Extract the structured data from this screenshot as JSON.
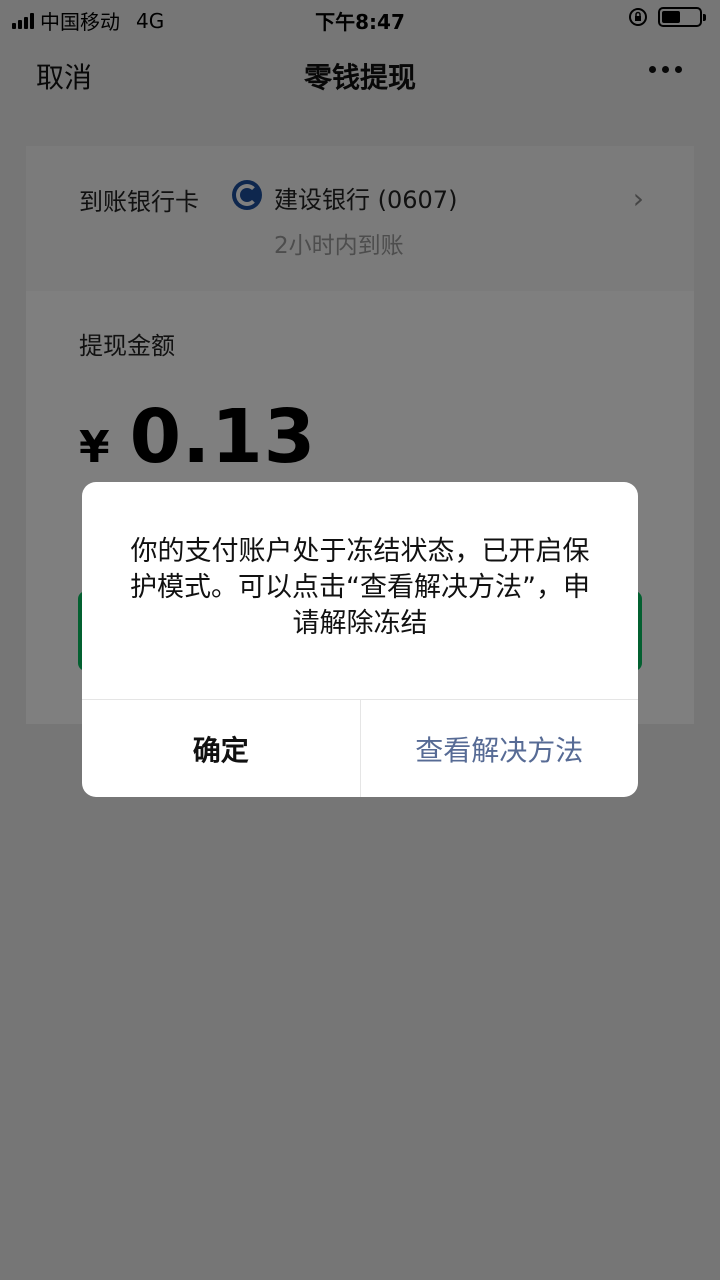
{
  "status_bar": {
    "carrier": "中国移动",
    "network": "4G",
    "time": "下午8:47"
  },
  "nav": {
    "cancel_label": "取消",
    "title": "零钱提现",
    "more_icon": "more-horizontal-icon"
  },
  "bank": {
    "label": "到账银行卡",
    "name": "建设银行 (0607)",
    "arrival_time": "2小时内到账",
    "logo_icon": "ccb-bank-logo",
    "logo_color": "#1d4f9c"
  },
  "amount": {
    "label": "提现金额",
    "currency": "¥",
    "value": "0.13"
  },
  "dialog": {
    "message": "你的支付账户处于冻结状态，已开启保护模式。可以点击“查看解决方法”，申请解除冻结",
    "confirm_label": "确定",
    "solution_label": "查看解决方法",
    "link_color": "#576b95"
  },
  "colors": {
    "primary_green": "#07c160",
    "overlay": "rgba(0,0,0,0.5)"
  }
}
